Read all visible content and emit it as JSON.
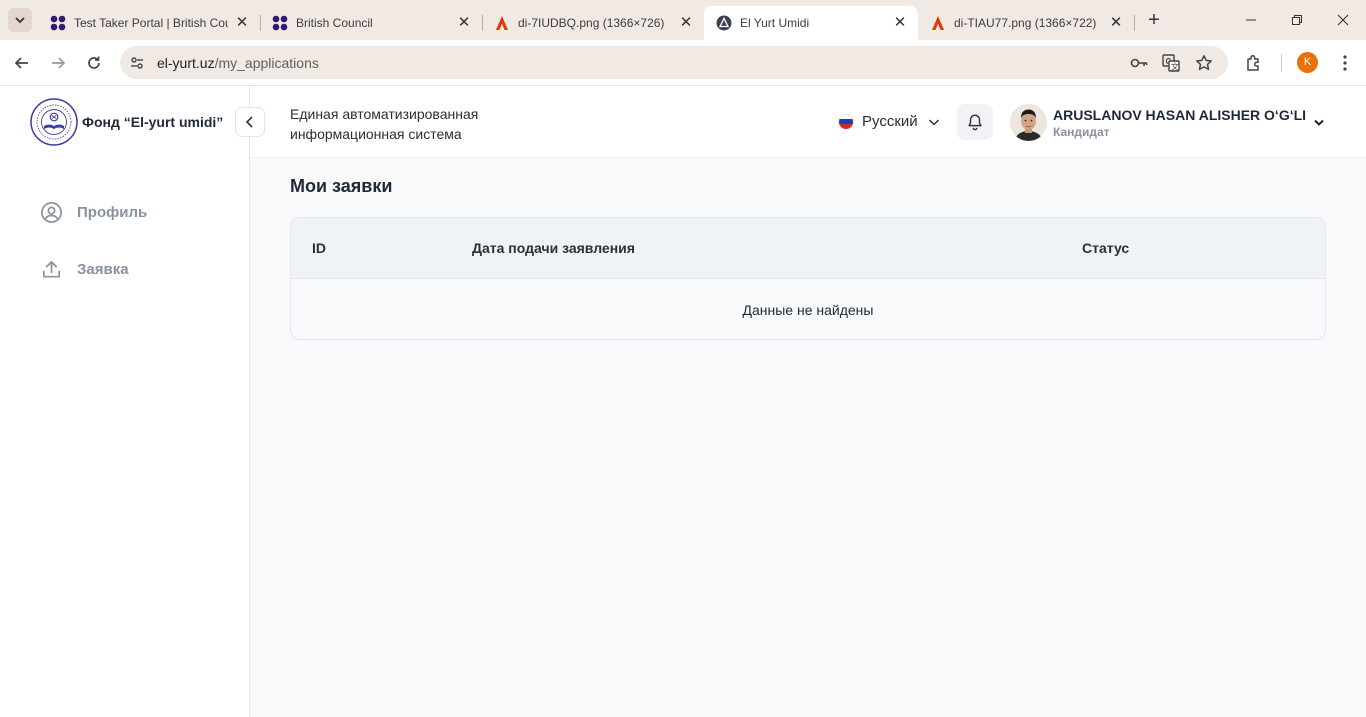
{
  "browser": {
    "tabs": [
      {
        "title": "Test Taker Portal | British Cou",
        "icon": "british-council-icon"
      },
      {
        "title": "British Council",
        "icon": "british-council-icon"
      },
      {
        "title": "di-7IUDBQ.png (1366×726)",
        "icon": "image-file-icon"
      },
      {
        "title": "El Yurt Umidi",
        "icon": "el-yurt-icon"
      },
      {
        "title": "di-TIAU77.png (1366×722)",
        "icon": "image-file-icon"
      }
    ],
    "close_glyph": "✕",
    "new_tab_glyph": "+",
    "url_host": "el-yurt.uz",
    "url_path": "/my_applications",
    "profile_initial": "K"
  },
  "sidebar": {
    "brand": "Фонд “El-yurt umidi”",
    "items": [
      {
        "label": "Профиль",
        "icon": "user-circle-icon"
      },
      {
        "label": "Заявка",
        "icon": "upload-icon"
      }
    ]
  },
  "header": {
    "system_title": "Единая автоматизированная информационная система",
    "language": "Русский",
    "user_name": "ARUSLANOV HASAN ALISHER O‘G‘LI",
    "user_role": "Кандидат"
  },
  "main": {
    "title": "Мои заявки",
    "columns": [
      "ID",
      "Дата подачи заявления",
      "Статус"
    ],
    "empty_text": "Данные не найдены"
  }
}
